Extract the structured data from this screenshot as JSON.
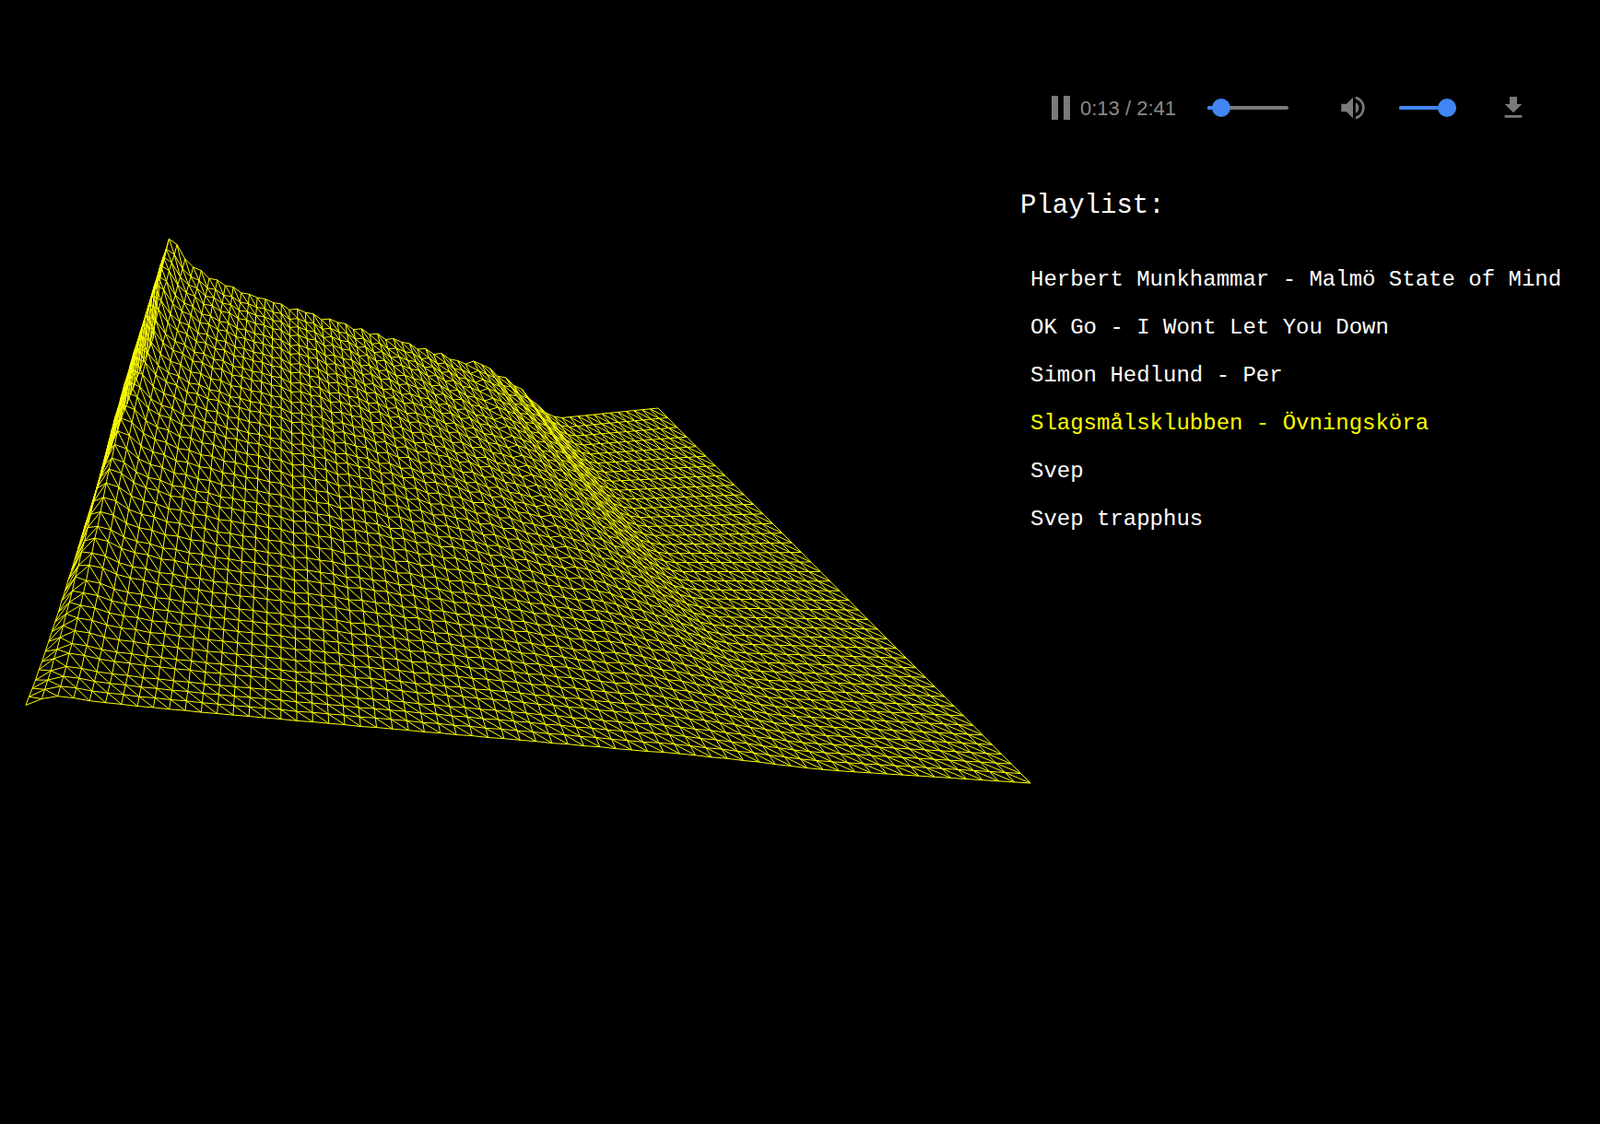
{
  "player": {
    "playing": true,
    "time": "0:13 / 2:41",
    "progress": 0.08,
    "volume": 1.0
  },
  "playlist": {
    "title": "Playlist:",
    "items": [
      {
        "label": "Herbert Munkhammar - Malmö State of Mind",
        "selected": false
      },
      {
        "label": "OK Go - I Wont Let You Down",
        "selected": false
      },
      {
        "label": "Simon Hedlund - Per",
        "selected": false
      },
      {
        "label": "Slagsmålsklubben - Övningsköra",
        "selected": true
      },
      {
        "label": "Svep",
        "selected": false
      },
      {
        "label": "Svep trapphus",
        "selected": false
      }
    ]
  },
  "visualizer": {
    "spectrum": [
      0.55,
      0.85,
      1.0,
      0.97,
      0.9,
      0.86,
      0.84,
      0.8,
      0.79,
      0.76,
      0.75,
      0.72,
      0.71,
      0.69,
      0.68,
      0.66,
      0.65,
      0.62,
      0.62,
      0.6,
      0.59,
      0.56,
      0.56,
      0.54,
      0.53,
      0.5,
      0.5,
      0.47,
      0.47,
      0.44,
      0.44,
      0.42,
      0.41,
      0.38,
      0.38,
      0.35,
      0.35,
      0.32,
      0.31,
      0.29,
      0.3,
      0.28,
      0.26,
      0.22,
      0.21,
      0.17,
      0.15,
      0.1,
      0.07,
      0.03,
      0.01,
      0,
      0,
      0,
      0,
      0,
      0,
      0,
      0,
      0,
      0,
      0,
      0,
      0
    ],
    "history": [
      1.0,
      0.97,
      0.95,
      0.93,
      0.9,
      0.88,
      0.85,
      0.83,
      0.8,
      0.78,
      0.75,
      0.72,
      0.7,
      0.67,
      0.64,
      0.62,
      0.59,
      0.56,
      0.53,
      0.5,
      0.47,
      0.45,
      0.42,
      0.39,
      0.36,
      0.33,
      0.31,
      0.28,
      0.26,
      0.23,
      0.21,
      0.19,
      0.17,
      0.15,
      0.13,
      0.12,
      0.1,
      0.09,
      0.08,
      0.07
    ]
  }
}
